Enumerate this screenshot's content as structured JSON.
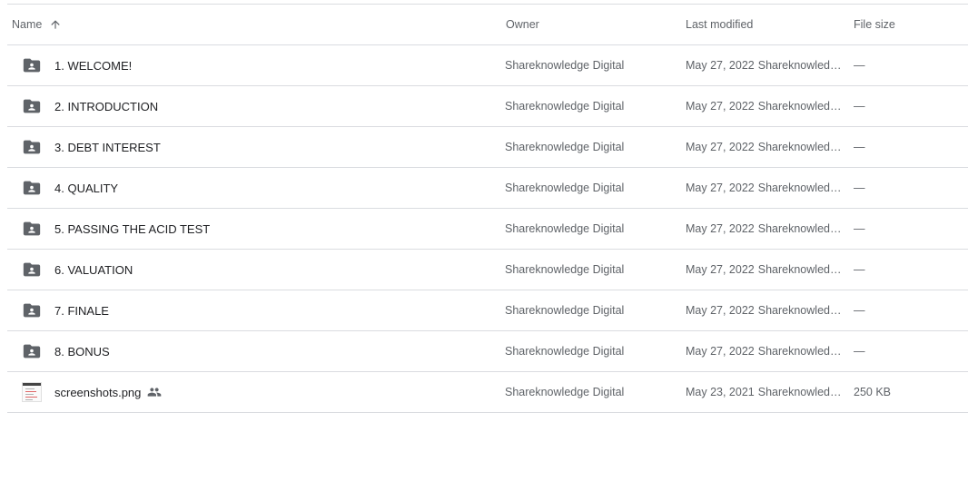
{
  "header": {
    "name": "Name",
    "owner": "Owner",
    "last_modified": "Last modified",
    "file_size": "File size",
    "sort_icon": "arrow-up-icon"
  },
  "rows": [
    {
      "name": "1. WELCOME!",
      "type": "shared-folder",
      "owner": "Shareknowledge Digital",
      "date": "May 27, 2022",
      "modifier": "Shareknowledge Digital",
      "size": "—"
    },
    {
      "name": "2. INTRODUCTION",
      "type": "shared-folder",
      "owner": "Shareknowledge Digital",
      "date": "May 27, 2022",
      "modifier": "Shareknowledge Digital",
      "size": "—"
    },
    {
      "name": "3. DEBT INTEREST",
      "type": "shared-folder",
      "owner": "Shareknowledge Digital",
      "date": "May 27, 2022",
      "modifier": "Shareknowledge Digital",
      "size": "—"
    },
    {
      "name": "4. QUALITY",
      "type": "shared-folder",
      "owner": "Shareknowledge Digital",
      "date": "May 27, 2022",
      "modifier": "Shareknowledge Digital",
      "size": "—"
    },
    {
      "name": "5. PASSING THE ACID TEST",
      "type": "shared-folder",
      "owner": "Shareknowledge Digital",
      "date": "May 27, 2022",
      "modifier": "Shareknowledge Digital",
      "size": "—"
    },
    {
      "name": "6. VALUATION",
      "type": "shared-folder",
      "owner": "Shareknowledge Digital",
      "date": "May 27, 2022",
      "modifier": "Shareknowledge Digital",
      "size": "—"
    },
    {
      "name": "7. FINALE",
      "type": "shared-folder",
      "owner": "Shareknowledge Digital",
      "date": "May 27, 2022",
      "modifier": "Shareknowledge Digital",
      "size": "—"
    },
    {
      "name": "8. BONUS",
      "type": "shared-folder",
      "owner": "Shareknowledge Digital",
      "date": "May 27, 2022",
      "modifier": "Shareknowledge Digital",
      "size": "—"
    },
    {
      "name": "screenshots.png",
      "type": "image-file",
      "shared": true,
      "owner": "Shareknowledge Digital",
      "date": "May 23, 2021",
      "modifier": "Shareknowledge Digital",
      "size": "250 KB"
    }
  ],
  "colors": {
    "icon": "#5f6368",
    "text_primary": "#202124",
    "text_secondary": "#5f6368",
    "divider": "#dadce0"
  }
}
